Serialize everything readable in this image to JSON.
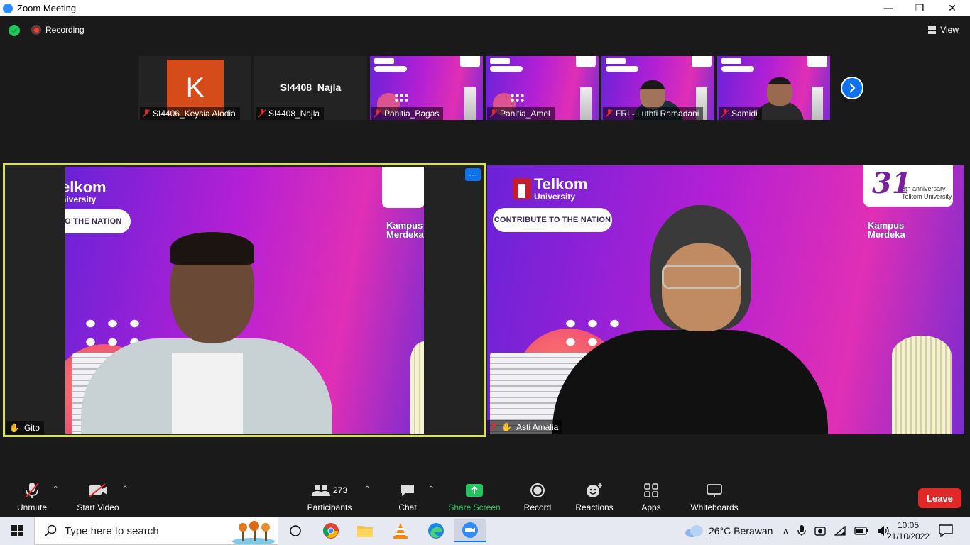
{
  "window": {
    "title": "Zoom Meeting",
    "controls": [
      "—",
      "❐",
      "✕"
    ]
  },
  "topbar": {
    "recording_label": "Recording",
    "view_label": "View"
  },
  "strip": [
    {
      "name": "SI4406_Keysia Alodia",
      "type": "avatar",
      "avatar_letter": "K",
      "avatar_color": "#d54b1a"
    },
    {
      "name": "SI4408_Najla",
      "type": "name",
      "display_name": "SI4408_Najla"
    },
    {
      "name": "Panitia_Bagas",
      "type": "bg"
    },
    {
      "name": "Panitia_Amel",
      "type": "bg"
    },
    {
      "name": "FRI - Luthfi Ramadani",
      "type": "person"
    },
    {
      "name": "Samidi",
      "type": "person"
    }
  ],
  "speakers": {
    "left": {
      "name": "Gito",
      "banner": "TO THE NATION",
      "logo_w1": "elkom",
      "logo_w2": "niversity",
      "kampus": "Kampus Merdeka",
      "more": "···"
    },
    "right": {
      "name": "Asti Amalia",
      "banner": "CONTRIBUTE TO THE NATION",
      "logo_w1": "Telkom",
      "logo_w2": "University",
      "anniversary": "31",
      "anniversary_sub1": "8th anniversary",
      "anniversary_sub2": "Telkom University",
      "kampus": "Kampus Merdeka"
    }
  },
  "toolbar": {
    "unmute": "Unmute",
    "start_video": "Start Video",
    "participants_count": "273",
    "participants": "Participants",
    "chat": "Chat",
    "share_screen": "Share Screen",
    "record": "Record",
    "reactions": "Reactions",
    "apps": "Apps",
    "whiteboards": "Whiteboards",
    "leave": "Leave"
  },
  "taskbar": {
    "search_placeholder": "Type here to search",
    "weather": "26°C  Berawan",
    "time": "10:05",
    "date": "21/10/2022"
  },
  "colors": {
    "accent": "#0e72ed",
    "leave": "#e02828",
    "share": "#23c55e",
    "active_speaker_border": "#d6e34f"
  }
}
